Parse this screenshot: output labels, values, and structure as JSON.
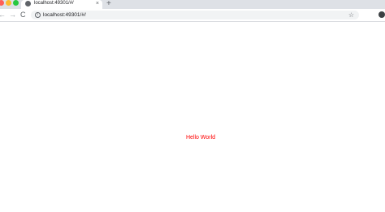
{
  "tab": {
    "title": "localhost:49301/#/",
    "close_glyph": "×"
  },
  "toolbar": {
    "new_tab_glyph": "+",
    "back_glyph": "←",
    "forward_glyph": "→",
    "reload_glyph": "C",
    "info_glyph": "i",
    "url": "localhost:49301/#/",
    "star_glyph": "☆"
  },
  "page": {
    "message": "Hello World",
    "message_color": "#ff0000"
  },
  "icons": {
    "favicon": "globe-icon",
    "back": "arrow-left-icon",
    "forward": "arrow-right-icon",
    "reload": "reload-icon",
    "info": "info-icon",
    "bookmark": "star-icon",
    "extension": "extension-icon"
  }
}
